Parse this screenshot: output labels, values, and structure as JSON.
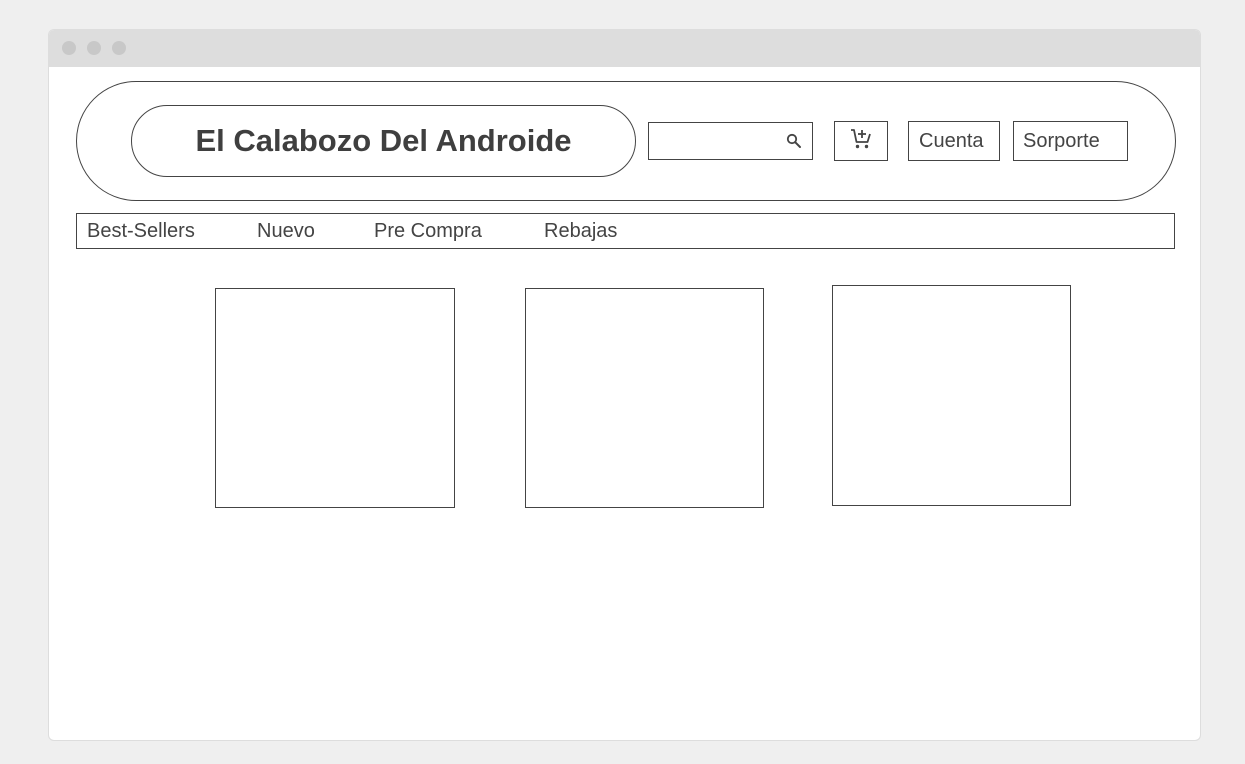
{
  "header": {
    "logo_text": "El Calabozo Del Androide",
    "search": {
      "value": "",
      "placeholder": ""
    },
    "cart_icon": "cart-add-icon",
    "account_label": "Cuenta",
    "support_label": "Sorporte"
  },
  "nav": {
    "items": [
      {
        "label": "Best-Sellers"
      },
      {
        "label": "Nuevo"
      },
      {
        "label": "Pre Compra"
      },
      {
        "label": "Rebajas"
      }
    ]
  },
  "icons": {
    "search": "search-icon",
    "cart": "cart-add-icon"
  },
  "colors": {
    "page_background": "#efefef",
    "window_background": "#ffffff",
    "titlebar": "#dddddd",
    "outline": "#444444",
    "text": "#444444"
  }
}
